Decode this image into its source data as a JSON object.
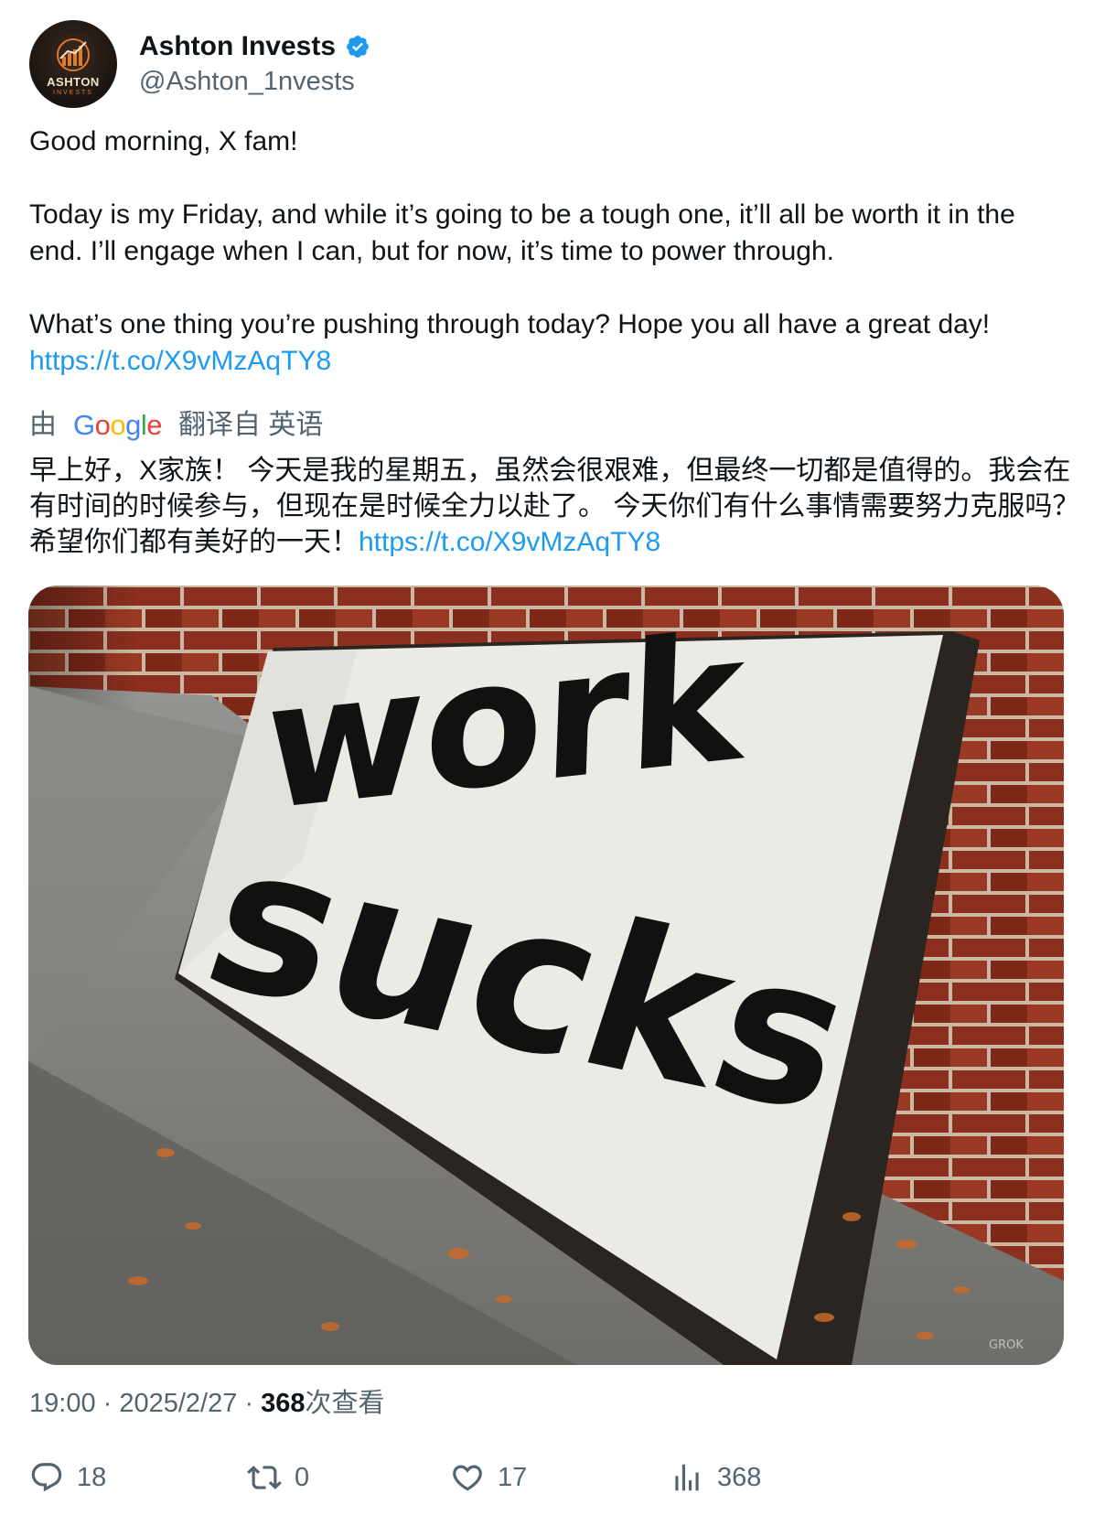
{
  "author": {
    "display_name": "Ashton Invests",
    "handle": "@Ashton_1nvests",
    "avatar_wordmark": "ASHTON",
    "avatar_sub": "INVESTS",
    "verified_icon": "verified-badge-icon"
  },
  "tweet": {
    "line1": "Good morning, X fam!",
    "para2": "Today is my Friday, and while it’s going to be a tough one, it’ll all be worth it in the end. I’ll engage when I can, but for now, it’s time to power through.",
    "para3": "What’s one thing you’re pushing through today? Hope you all have a great day!",
    "link": "https://t.co/X9vMzAqTY8"
  },
  "translation": {
    "prefix": "由",
    "suffix": "翻译自 英语",
    "text": "早上好，X家族！ 今天是我的星期五，虽然会很艰难，但最终一切都是值得的。我会在有时间的时候参与，但现在是时候全力以赴了。 今天你们有什么事情需要努力克服吗？希望你们都有美好的一天！",
    "link": "https://t.co/X9vMzAqTY8"
  },
  "media": {
    "sign_line1": "work",
    "sign_line2": "sucks",
    "watermark": "GROK"
  },
  "meta": {
    "time": "19:00",
    "date": "2025/2/27",
    "views_count": "368",
    "views_label": "次查看"
  },
  "actions": {
    "replies": "18",
    "reposts": "0",
    "likes": "17",
    "views": "368"
  },
  "colors": {
    "link": "#1d9bf0",
    "secondary_text": "#536471",
    "verified": "#1d9bf0"
  }
}
